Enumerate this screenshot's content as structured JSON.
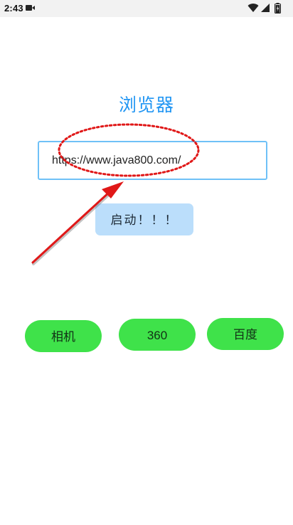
{
  "status_bar": {
    "time": "2:43"
  },
  "app": {
    "title": "浏览器",
    "url_value": "https://www.java800.com/",
    "start_button": "启动！！！"
  },
  "buttons": {
    "camera": "相机",
    "n360": "360",
    "baidu": "百度"
  },
  "colors": {
    "title": "#2196F3",
    "field_border": "#6FC1F7",
    "start_button_bg": "#BBDEFB",
    "pill_bg": "#3FE24A",
    "annotation": "#E01818"
  },
  "icons": [
    "screen-record-icon",
    "wifi-icon",
    "signal-icon",
    "battery-icon"
  ]
}
